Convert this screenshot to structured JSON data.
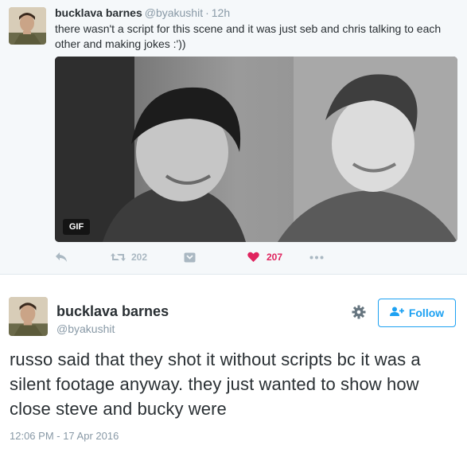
{
  "reply_tweet": {
    "author_name": "bucklava barnes",
    "author_handle": "@byakushit",
    "separator": "·",
    "time": "12h",
    "text": "there wasn't a script for this scene and it was just seb and chris talking to each other and making jokes :'))",
    "media": {
      "badge": "GIF"
    },
    "actions": {
      "reply_icon": "reply-icon",
      "retweet_icon": "retweet-icon",
      "retweet_count": "202",
      "save_icon": "bookmark-icon",
      "like_icon": "heart-icon",
      "like_count": "207",
      "more_icon": "more-dots-icon"
    }
  },
  "main_tweet": {
    "author_name": "bucklava barnes",
    "author_handle": "@byakushit",
    "settings_icon": "gear-icon",
    "follow_label": "Follow",
    "follow_icon": "follow-user-icon",
    "text": "russo said that they shot it without scripts bc it was a silent footage anyway. they just wanted to show how close steve and bucky were",
    "timestamp": "12:06 PM - 17 Apr 2016"
  },
  "colors": {
    "link_blue": "#1da1f2",
    "like_red": "#e0245e",
    "muted_gray": "#8899a6",
    "action_gray": "#aab8c2",
    "context_bg": "#f5f8fa"
  }
}
